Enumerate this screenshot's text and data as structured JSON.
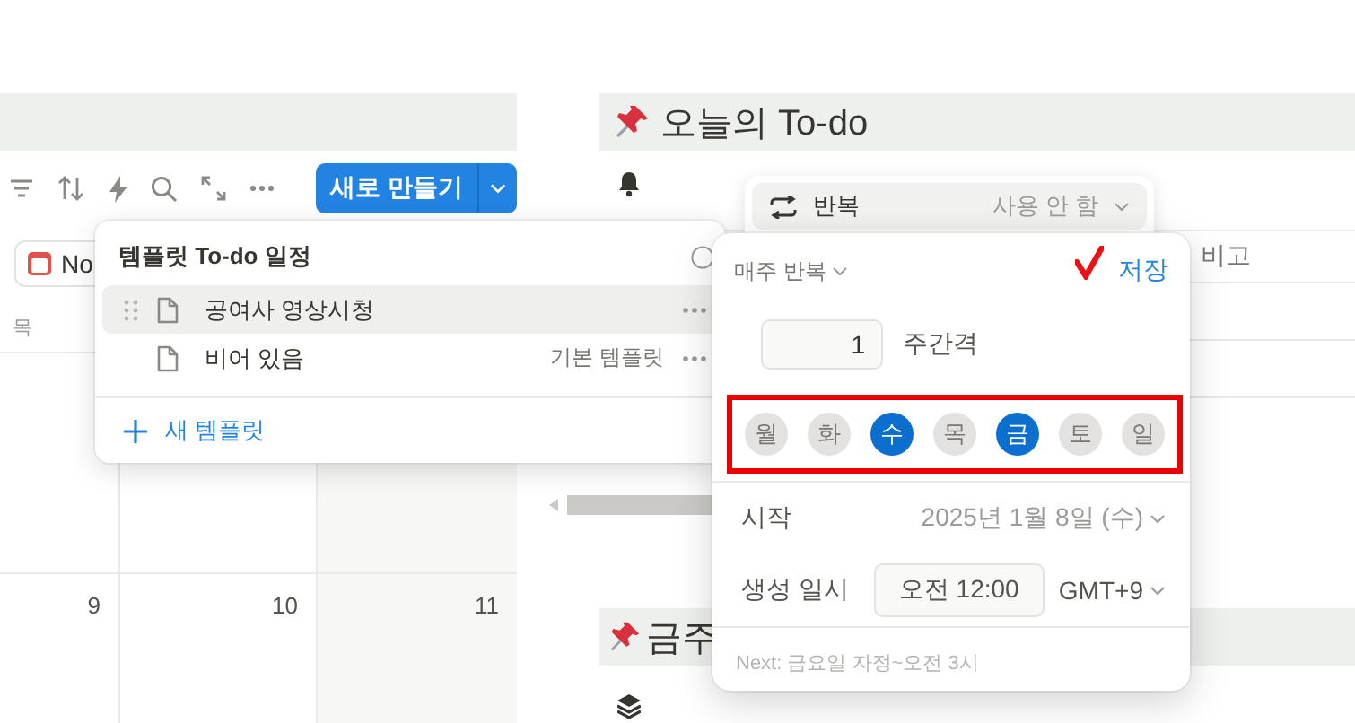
{
  "calendar": {
    "new_button": "새로 만들기",
    "view_chip": "No",
    "weekday": "목",
    "dates": [
      "9",
      "10",
      "11"
    ]
  },
  "page": {
    "heading": "오늘의 To-do",
    "column": "비고",
    "next_heading": "금주"
  },
  "template_menu": {
    "title": "템플릿 To-do 일정",
    "items": [
      {
        "label": "공여사 영상시청",
        "selected": true
      },
      {
        "label": "비어 있음",
        "selected": false,
        "tag": "기본 템플릿"
      }
    ],
    "new_template": "새 템플릿"
  },
  "repeat_property": {
    "label": "반복",
    "value": "사용 안 함"
  },
  "repeat_popup": {
    "frequency": "매주 반복",
    "save": "저장",
    "interval": "1",
    "interval_unit": "주간격",
    "days": [
      {
        "label": "월",
        "selected": false
      },
      {
        "label": "화",
        "selected": false
      },
      {
        "label": "수",
        "selected": true
      },
      {
        "label": "목",
        "selected": false
      },
      {
        "label": "금",
        "selected": true
      },
      {
        "label": "토",
        "selected": false
      },
      {
        "label": "일",
        "selected": false
      }
    ],
    "start_label": "시작",
    "start_value": "2025년 1월 8일 (수)",
    "time_label": "생성 일시",
    "time": "오전 12:00",
    "timezone": "GMT+9",
    "next": "Next: 금요일 자정~오전 3시"
  }
}
